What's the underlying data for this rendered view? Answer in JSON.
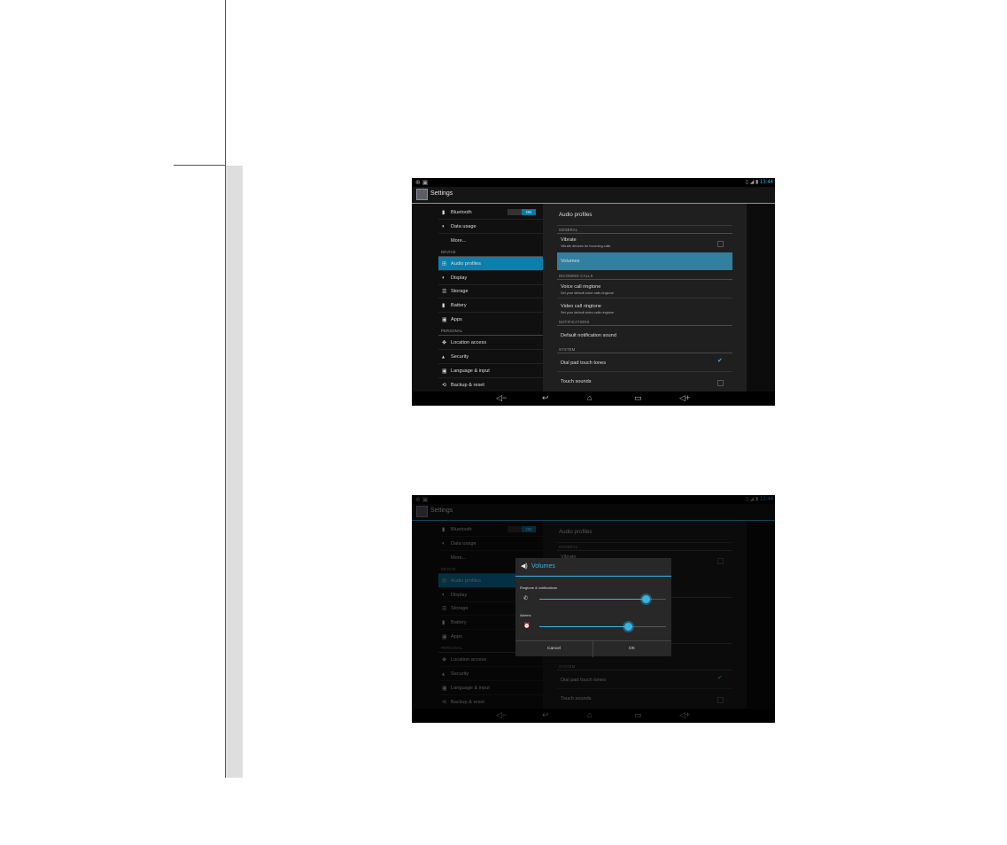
{
  "statusbar": {
    "left_icons": "⊕ ▣",
    "right_icons": "▯ ◢ ▮",
    "time": "13:44"
  },
  "app": {
    "title": "Settings"
  },
  "sidebar": {
    "bluetooth": {
      "label": "Bluetooth",
      "icon": "bluetooth-icon",
      "toggle": "ON"
    },
    "data_usage": "Data usage",
    "more": "More...",
    "device_header": "DEVICE",
    "audio_profiles": "Audio profiles",
    "display": "Display",
    "storage": "Storage",
    "battery": "Battery",
    "apps": "Apps",
    "personal_header": "PERSONAL",
    "location_access": "Location access",
    "security": "Security",
    "language_input": "Language & input",
    "backup_reset": "Backup & reset"
  },
  "audio": {
    "title": "Audio profiles",
    "general_header": "GENERAL",
    "vibrate": {
      "title": "Vibrate",
      "subtitle": "Vibrate devices for incoming calls",
      "checked": false
    },
    "volumes": "Volumes",
    "incoming_header": "INCOMING CALLS",
    "voice_ringtone": {
      "title": "Voice call ringtone",
      "subtitle": "Set your default voice calls ringtone"
    },
    "video_ringtone": {
      "title": "Video call ringtone",
      "subtitle": "Set your default video calls ringtone"
    },
    "notifications_header": "NOTIFICATIONS",
    "default_notification": "Default notification sound",
    "system_header": "SYSTEM",
    "dial_pad": {
      "title": "Dial pad touch tones",
      "checked": true
    },
    "touch_sounds": {
      "title": "Touch sounds",
      "checked": false
    }
  },
  "volumes_dialog": {
    "title": "Volumes",
    "ringtone_label": "Ringtone & notifications",
    "ringtone_level": 0.84,
    "alarms_label": "Alarms",
    "alarms_level": 0.7,
    "cancel": "Cancel",
    "ok": "OK"
  },
  "colors": {
    "accent": "#33b5e5",
    "selected": "#0b7fae"
  }
}
